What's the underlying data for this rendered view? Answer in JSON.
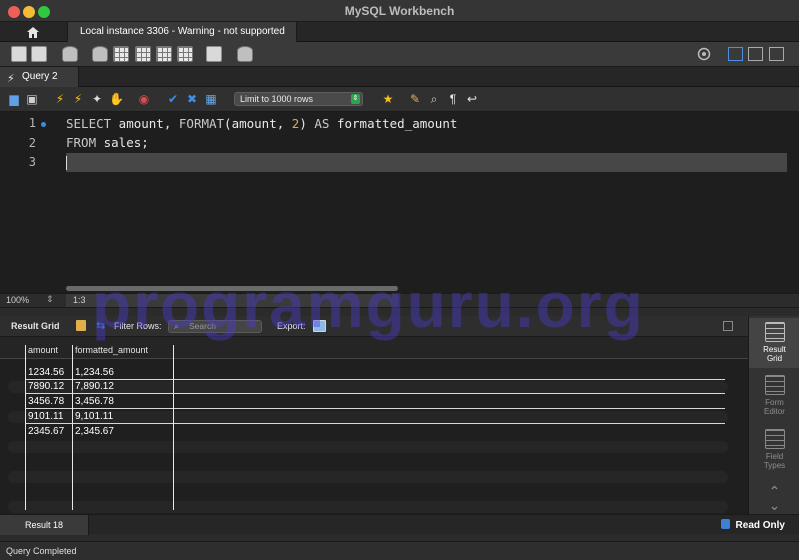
{
  "window": {
    "title": "MySQL Workbench"
  },
  "connection_tab": {
    "label": "Local instance 3306 - Warning - not supported"
  },
  "query_tab": {
    "label": "Query 2"
  },
  "editor_toolbar": {
    "limit_select": "Limit to 1000 rows"
  },
  "editor": {
    "line_numbers": [
      "1",
      "2",
      "3"
    ],
    "lines": [
      {
        "kw1": "SELECT",
        "t1": " amount, ",
        "kw2": "FORMAT",
        "t2": "(amount, ",
        "num": "2",
        "t3": ") ",
        "kw3": "AS",
        "t4": " formatted_amount"
      },
      {
        "kw1": "FROM",
        "t1": " sales;"
      }
    ]
  },
  "status_row": {
    "zoom": "100%",
    "cursor_position": "1:3"
  },
  "result_toolbar": {
    "result_grid_label": "Result Grid",
    "filter_label": "Filter Rows:",
    "search_placeholder": "Search",
    "export_label": "Export:"
  },
  "grid": {
    "columns": [
      "amount",
      "formatted_amount"
    ],
    "rows": [
      [
        "1234.56",
        "1,234.56"
      ],
      [
        "7890.12",
        "7,890.12"
      ],
      [
        "3456.78",
        "3,456.78"
      ],
      [
        "9101.11",
        "9,101.11"
      ],
      [
        "2345.67",
        "2,345.67"
      ]
    ]
  },
  "side_panel": {
    "result_grid": {
      "line1": "Result",
      "line2": "Grid"
    },
    "form_editor": {
      "line1": "Form",
      "line2": "Editor"
    },
    "field_types": {
      "line1": "Field",
      "line2": "Types"
    }
  },
  "result_tabs": {
    "tab": "Result 18",
    "read_only": "Read Only"
  },
  "statusbar": {
    "text": "Query Completed"
  },
  "watermark": {
    "text": "programguru.org"
  },
  "colors": {
    "accent": "#3c8de0",
    "number": "#e4a64a",
    "watermark": "#4b3cd2"
  }
}
